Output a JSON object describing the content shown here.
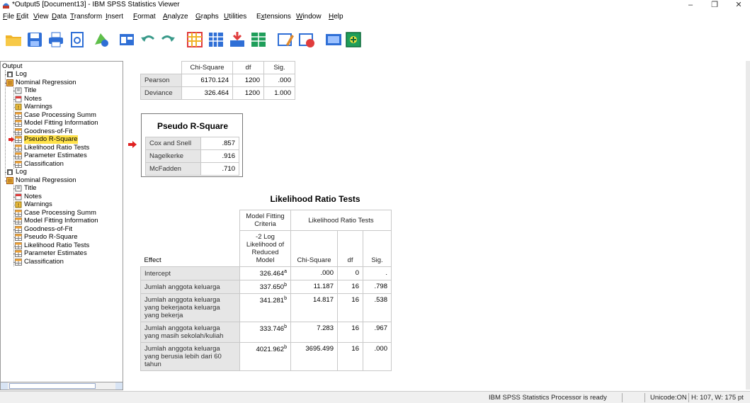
{
  "window": {
    "title": "*Output5 [Document13] - IBM SPSS Statistics Viewer"
  },
  "menu": [
    {
      "label": "File",
      "u": "F",
      "rest": "ile"
    },
    {
      "label": "Edit",
      "u": "E",
      "rest": "dit"
    },
    {
      "label": "View",
      "u": "V",
      "rest": "iew"
    },
    {
      "label": "Data",
      "u": "D",
      "rest": "ata"
    },
    {
      "label": "Transform",
      "u": "T",
      "rest": "ransform"
    },
    {
      "label": "Insert",
      "u": "I",
      "rest": "nsert"
    },
    {
      "label": "Format",
      "u": "F",
      "rest": "ormat",
      "pre": ""
    },
    {
      "label": "Analyze",
      "u": "A",
      "rest": "nalyze"
    },
    {
      "label": "Graphs",
      "u": "G",
      "rest": "raphs"
    },
    {
      "label": "Utilities",
      "u": "U",
      "rest": "tilities"
    },
    {
      "label": "Extensions",
      "u": "x",
      "pre": "E",
      "rest": "tensions"
    },
    {
      "label": "Window",
      "u": "W",
      "rest": "indow"
    },
    {
      "label": "Help",
      "u": "H",
      "rest": "elp"
    }
  ],
  "outline": {
    "root": "Output",
    "items": [
      {
        "label": "Log",
        "kind": "log",
        "level": 1
      },
      {
        "label": "Nominal Regression",
        "kind": "proc",
        "level": 1
      },
      {
        "label": "Title",
        "kind": "title",
        "level": 2
      },
      {
        "label": "Notes",
        "kind": "notes",
        "level": 2
      },
      {
        "label": "Warnings",
        "kind": "warn",
        "level": 2
      },
      {
        "label": "Case Processing Summ",
        "kind": "table",
        "level": 2
      },
      {
        "label": "Model Fitting Information",
        "kind": "table",
        "level": 2
      },
      {
        "label": "Goodness-of-Fit",
        "kind": "table",
        "level": 2
      },
      {
        "label": "Pseudo R-Square",
        "kind": "table",
        "level": 2,
        "selected": true
      },
      {
        "label": "Likelihood Ratio Tests",
        "kind": "table",
        "level": 2
      },
      {
        "label": "Parameter Estimates",
        "kind": "table",
        "level": 2
      },
      {
        "label": "Classification",
        "kind": "table",
        "level": 2
      },
      {
        "label": "Log",
        "kind": "log",
        "level": 1
      },
      {
        "label": "Nominal Regression",
        "kind": "proc",
        "level": 1
      },
      {
        "label": "Title",
        "kind": "title",
        "level": 2
      },
      {
        "label": "Notes",
        "kind": "notes",
        "level": 2
      },
      {
        "label": "Warnings",
        "kind": "warn",
        "level": 2
      },
      {
        "label": "Case Processing Summ",
        "kind": "table",
        "level": 2
      },
      {
        "label": "Model Fitting Information",
        "kind": "table",
        "level": 2
      },
      {
        "label": "Goodness-of-Fit",
        "kind": "table",
        "level": 2
      },
      {
        "label": "Pseudo R-Square",
        "kind": "table",
        "level": 2
      },
      {
        "label": "Likelihood Ratio Tests",
        "kind": "table",
        "level": 2
      },
      {
        "label": "Parameter Estimates",
        "kind": "table",
        "level": 2
      },
      {
        "label": "Classification",
        "kind": "table",
        "level": 2
      }
    ]
  },
  "goodness": {
    "headers": [
      "Chi-Square",
      "df",
      "Sig."
    ],
    "rows": [
      {
        "label": "Pearson",
        "chi": "6170.124",
        "df": "1200",
        "sig": ".000"
      },
      {
        "label": "Deviance",
        "chi": "326.464",
        "df": "1200",
        "sig": "1.000"
      }
    ]
  },
  "pseudo": {
    "title": "Pseudo R-Square",
    "rows": [
      {
        "label": "Cox and Snell",
        "value": ".857"
      },
      {
        "label": "Nagelkerke",
        "value": ".916"
      },
      {
        "label": "McFadden",
        "value": ".710"
      }
    ]
  },
  "lrt": {
    "title": "Likelihood Ratio Tests",
    "header_group1": "Model Fitting Criteria",
    "header_group2": "Likelihood Ratio Tests",
    "header_effect": "Effect",
    "header_ll": "-2 Log Likelihood of Reduced Model",
    "header_chi": "Chi-Square",
    "header_df": "df",
    "header_sig": "Sig.",
    "rows": [
      {
        "effect": "Intercept",
        "ll": "326.464",
        "sup": "a",
        "chi": ".000",
        "df": "0",
        "sig": "."
      },
      {
        "effect": "Jumlah anggota keluarga",
        "ll": "337.650",
        "sup": "b",
        "chi": "11.187",
        "df": "16",
        "sig": ".798"
      },
      {
        "effect": "Jumlah anggota keluarga yang bekerjaota keluarga yang bekerja",
        "ll": "341.281",
        "sup": "b",
        "chi": "14.817",
        "df": "16",
        "sig": ".538"
      },
      {
        "effect": "Jumlah anggota keluarga yang masih sekolah/kuliah",
        "ll": "333.746",
        "sup": "b",
        "chi": "7.283",
        "df": "16",
        "sig": ".967"
      },
      {
        "effect": "Jumlah anggota keluarga yang berusia lebih dari 60 tahun",
        "ll": "4021.962",
        "sup": "b",
        "chi": "3695.499",
        "df": "16",
        "sig": ".000"
      }
    ]
  },
  "status": {
    "processor": "IBM SPSS Statistics Processor is ready",
    "unicode": "Unicode:ON",
    "size": "H: 107, W: 175 pt"
  },
  "colors": {
    "selection": "#ffe24a",
    "arrow": "#e02020"
  }
}
